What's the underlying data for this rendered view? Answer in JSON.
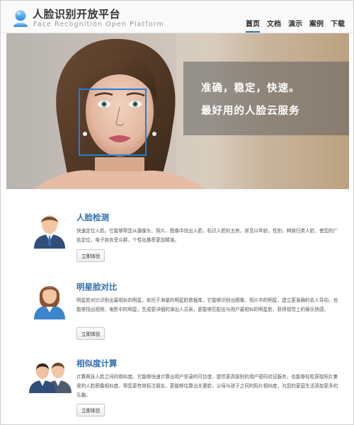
{
  "header": {
    "title": "人脸识别开放平台",
    "subtitle": "Face Recognition Open Platform",
    "nav": [
      {
        "label": "首页"
      },
      {
        "label": "文档"
      },
      {
        "label": "演示"
      },
      {
        "label": "案例"
      },
      {
        "label": "下载"
      }
    ],
    "active_nav": "首页"
  },
  "hero": {
    "line1": "准确，稳定，快速。",
    "line2": "最好用的人脸云服务"
  },
  "features": [
    {
      "title": "人脸检测",
      "desc": "快速定位人脸。它能够帮您从摄像头、照片、图像中找出人脸，标识人脸的五官，甚至以年龄，性别，种族归类人脸，使您的广告定位，电子商务受众群，个性化推荐更加精准。",
      "button": "立即体验",
      "icon": "man-avatar-icon"
    },
    {
      "title": "明星脸对比",
      "desc": "明星脸对比识别出最相似的明星。依托于海量的明星脸数据库，它能够识别出图像、照片中的明星，建立更准确的名人导向，也能够找出视频、电影中的明星，生成更详细的演出人员表，更能够匹配出与用户最相似的明星脸，获得视觉上的娱乐快感。",
      "button": "立即体验",
      "icon": "woman-avatar-icon"
    },
    {
      "title": "相似度计算",
      "desc": "计算两张人脸之间的相似度。它能够快速计算出用户登录的可信度，提供更高级别的用户密码验证服务，也能够轻松获取照片集里的人脸图像相似度，帮您更有效标注朋友，更能够估算出夫妻脸，父母与孩子之间的照片相似度，为您的家庭生活添加更多的乐趣。",
      "button": "立即体验",
      "icon": "two-people-avatar-icon"
    }
  ],
  "colors": {
    "accent": "#2f6fb0",
    "face_box": "#1f7fd8"
  }
}
